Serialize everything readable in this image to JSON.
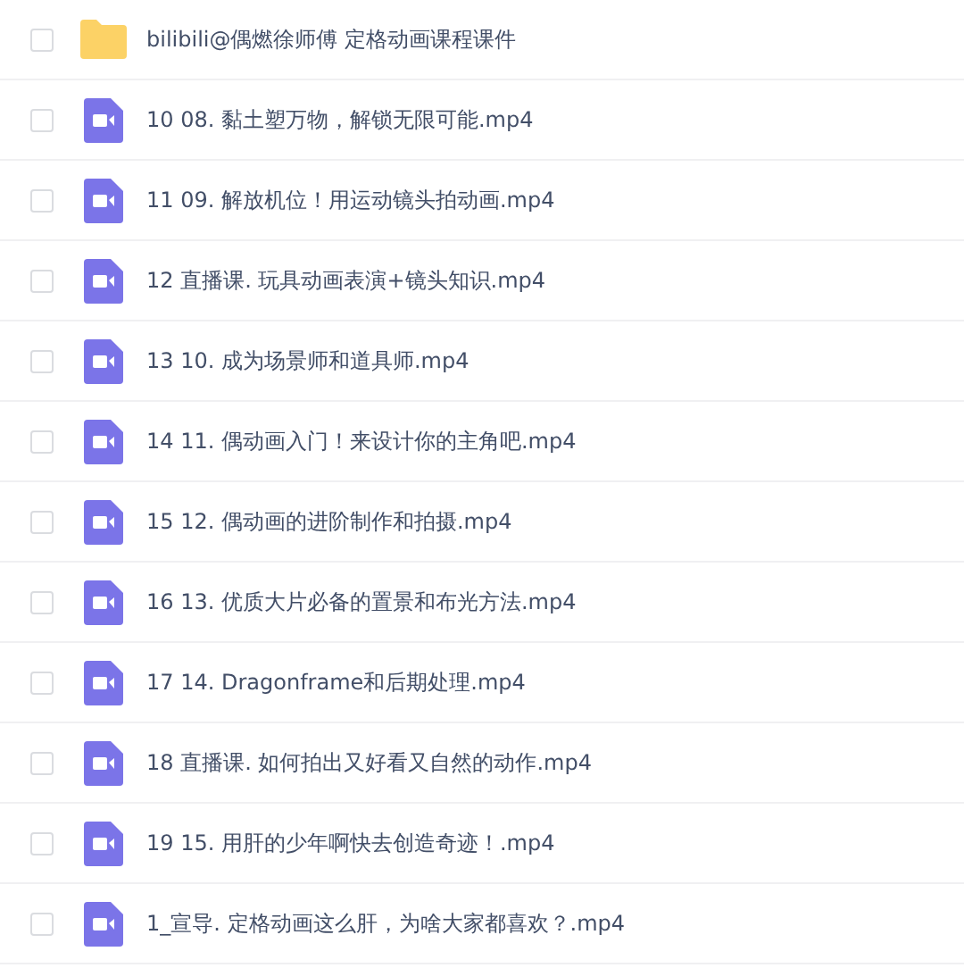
{
  "files": [
    {
      "kind": "folder",
      "name": "bilibili@偶燃徐师傅 定格动画课程课件",
      "checked": false
    },
    {
      "kind": "video",
      "name": "10 08. 黏土塑万物，解锁无限可能.mp4",
      "checked": false
    },
    {
      "kind": "video",
      "name": "11 09. 解放机位！用运动镜头拍动画.mp4",
      "checked": false
    },
    {
      "kind": "video",
      "name": "12 直播课. 玩具动画表演+镜头知识.mp4",
      "checked": false
    },
    {
      "kind": "video",
      "name": "13 10. 成为场景师和道具师.mp4",
      "checked": false
    },
    {
      "kind": "video",
      "name": "14 11. 偶动画入门！来设计你的主角吧.mp4",
      "checked": false
    },
    {
      "kind": "video",
      "name": "15 12. 偶动画的进阶制作和拍摄.mp4",
      "checked": false
    },
    {
      "kind": "video",
      "name": "16 13. 优质大片必备的置景和布光方法.mp4",
      "checked": false
    },
    {
      "kind": "video",
      "name": "17 14. Dragonframe和后期处理.mp4",
      "checked": false
    },
    {
      "kind": "video",
      "name": "18 直播课. 如何拍出又好看又自然的动作.mp4",
      "checked": false
    },
    {
      "kind": "video",
      "name": "19 15. 用肝的少年啊快去创造奇迹！.mp4",
      "checked": false
    },
    {
      "kind": "video",
      "name": "1_宣导. 定格动画这么肝，为啥大家都喜欢？.mp4",
      "checked": false
    }
  ]
}
